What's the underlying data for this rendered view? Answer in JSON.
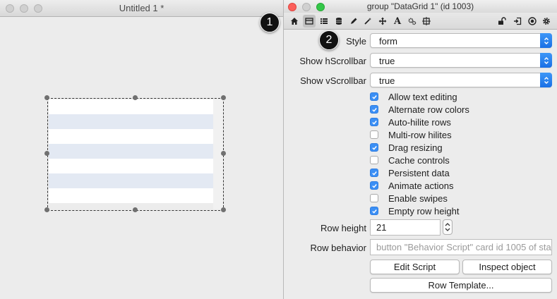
{
  "left_window": {
    "title": "Untitled 1 *"
  },
  "right_window": {
    "title": "group \"DataGrid 1\" (id 1003)",
    "toolbar_icons": [
      "home-icon",
      "basic-properties-icon",
      "list-icon",
      "database-icon",
      "pencil-icon",
      "wand-icon",
      "move-icon",
      "text-icon",
      "gears-icon",
      "resize-icon",
      "lock-icon",
      "sign-in-icon",
      "target-icon",
      "gear-icon"
    ]
  },
  "properties": {
    "style": {
      "label": "Style",
      "value": "form"
    },
    "show_hscrollbar": {
      "label": "Show hScrollbar",
      "value": "true"
    },
    "show_vscrollbar": {
      "label": "Show vScrollbar",
      "value": "true"
    },
    "checkboxes": [
      {
        "label": "Allow text editing",
        "checked": true
      },
      {
        "label": "Alternate row colors",
        "checked": true
      },
      {
        "label": "Auto-hilite rows",
        "checked": true
      },
      {
        "label": "Multi-row hilites",
        "checked": false
      },
      {
        "label": "Drag resizing",
        "checked": true
      },
      {
        "label": "Cache controls",
        "checked": false
      },
      {
        "label": "Persistent data",
        "checked": true
      },
      {
        "label": "Animate actions",
        "checked": true
      },
      {
        "label": "Enable swipes",
        "checked": false
      },
      {
        "label": "Empty row height",
        "checked": true
      }
    ],
    "row_height": {
      "label": "Row height",
      "value": "21"
    },
    "row_behavior": {
      "label": "Row behavior",
      "value": "button \"Behavior Script\" card  id 1005 of sta"
    },
    "buttons": {
      "edit_script": "Edit Script",
      "inspect_object": "Inspect object",
      "row_template": "Row Template..."
    }
  },
  "callouts": {
    "one": "1",
    "two": "2"
  },
  "colors": {
    "accent": "#3b8ff5",
    "alt_row": "#e3e9f3"
  }
}
